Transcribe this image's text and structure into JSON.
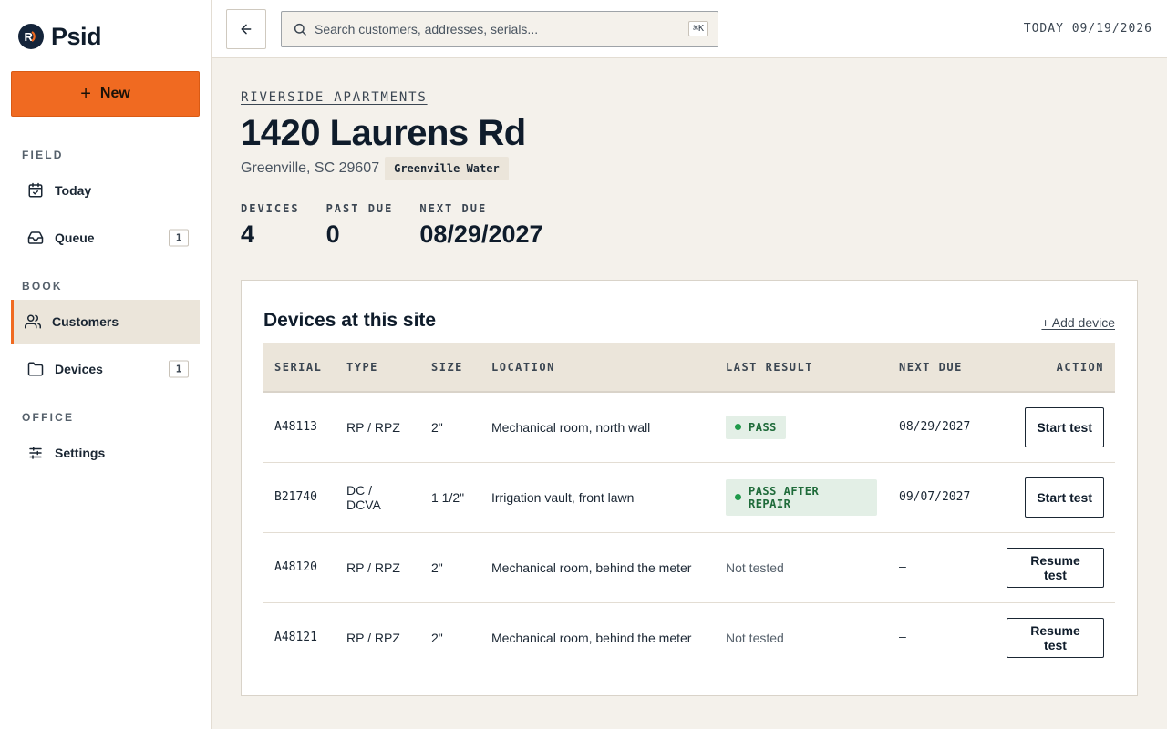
{
  "brand": {
    "name": "Psid"
  },
  "sidebar": {
    "new_label": "New",
    "sections": [
      {
        "label": "FIELD",
        "items": [
          {
            "label": "Today",
            "icon": "calendar-check-icon"
          },
          {
            "label": "Queue",
            "icon": "inbox-icon",
            "badge": "1"
          }
        ]
      },
      {
        "label": "BOOK",
        "items": [
          {
            "label": "Customers",
            "icon": "users-icon",
            "active": true
          },
          {
            "label": "Devices",
            "icon": "folder-icon",
            "badge": "1"
          }
        ]
      },
      {
        "label": "OFFICE",
        "items": [
          {
            "label": "Settings",
            "icon": "sliders-icon"
          }
        ]
      }
    ]
  },
  "topbar": {
    "search_placeholder": "Search customers, addresses, serials...",
    "shortcut": "⌘K",
    "today": "TODAY 09/19/2026"
  },
  "site": {
    "customer": "RIVERSIDE APARTMENTS",
    "address": "1420 Laurens Rd",
    "city": "Greenville, SC 29607",
    "utility": "Greenville Water",
    "stats": [
      {
        "label": "DEVICES",
        "value": "4"
      },
      {
        "label": "PAST DUE",
        "value": "0"
      },
      {
        "label": "NEXT DUE",
        "value": "08/29/2027"
      }
    ]
  },
  "devices": {
    "title": "Devices at this site",
    "add_label": "+ Add device",
    "columns": [
      "SERIAL",
      "TYPE",
      "SIZE",
      "LOCATION",
      "LAST RESULT",
      "NEXT DUE",
      "ACTION"
    ],
    "rows": [
      {
        "serial": "A48113",
        "type": "RP / RPZ",
        "size": "2\"",
        "location": "Mechanical room, north wall",
        "result": "PASS",
        "result_kind": "pill",
        "next_due": "08/29/2027",
        "action": "Start test"
      },
      {
        "serial": "B21740",
        "type": "DC / DCVA",
        "size": "1 1/2\"",
        "location": "Irrigation vault, front lawn",
        "result": "PASS AFTER REPAIR",
        "result_kind": "pill",
        "next_due": "09/07/2027",
        "action": "Start test"
      },
      {
        "serial": "A48120",
        "type": "RP / RPZ",
        "size": "2\"",
        "location": "Mechanical room, behind the meter",
        "result": "Not tested",
        "result_kind": "text",
        "next_due": "–",
        "action": "Resume test"
      },
      {
        "serial": "A48121",
        "type": "RP / RPZ",
        "size": "2\"",
        "location": "Mechanical room, behind the meter",
        "result": "Not tested",
        "result_kind": "text",
        "next_due": "–",
        "action": "Resume test"
      }
    ]
  },
  "colors": {
    "accent": "#f06a21",
    "navy": "#14243a",
    "pass_bg": "#e3efe6",
    "pass_fg": "#1f6b3a"
  }
}
